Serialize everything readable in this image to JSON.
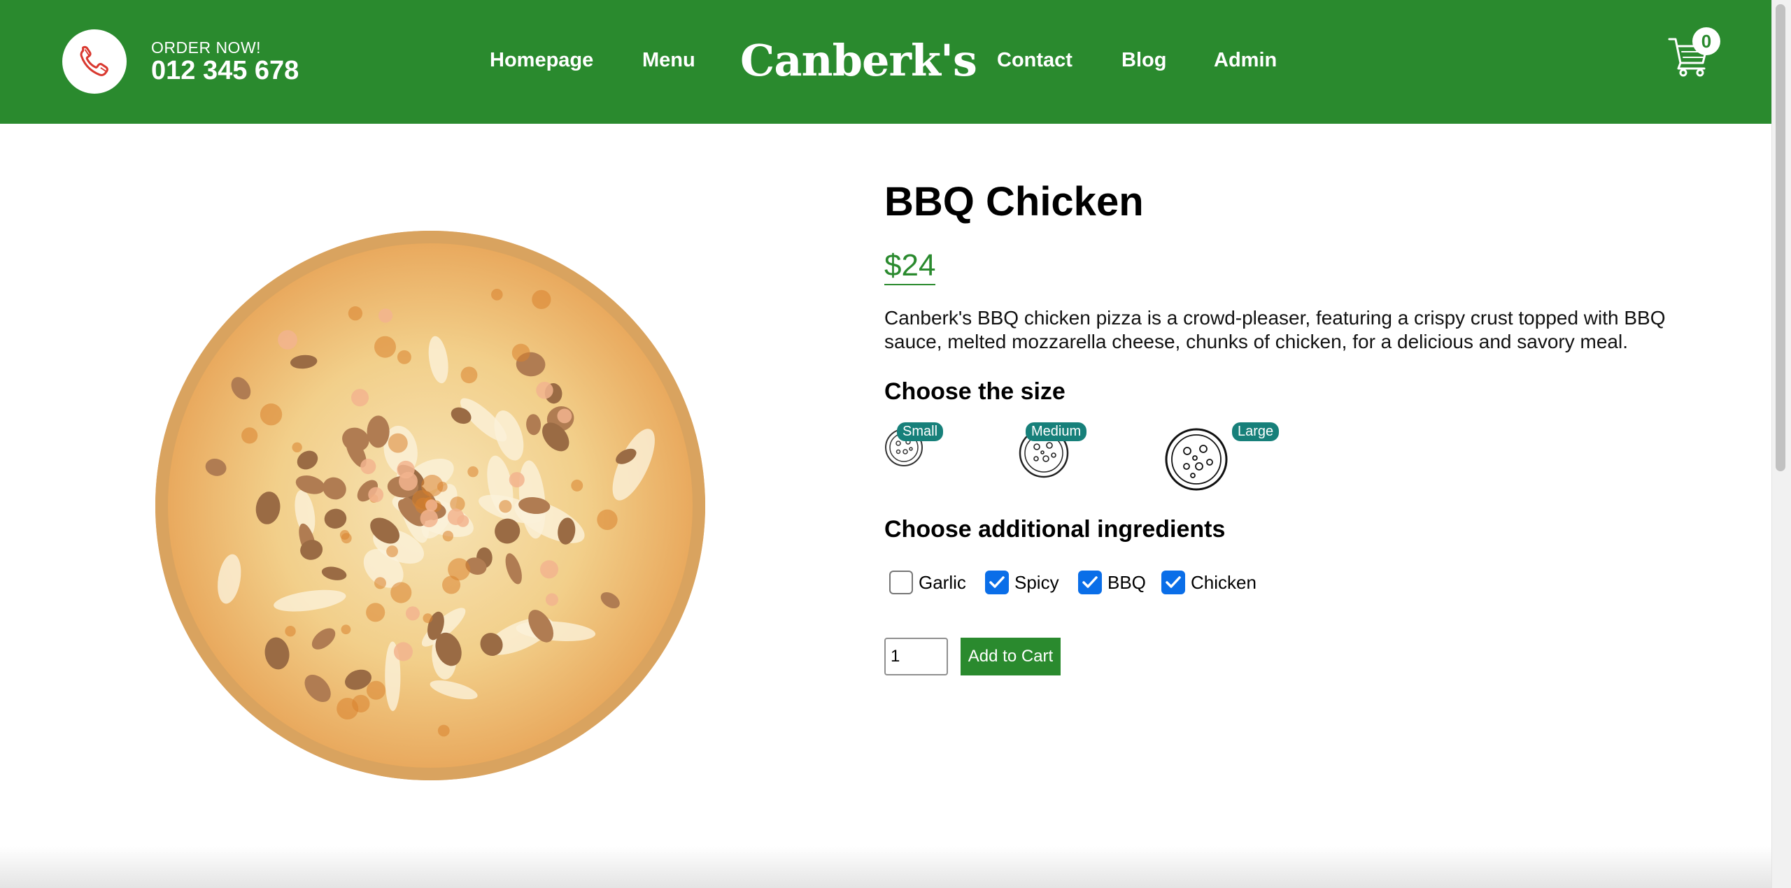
{
  "header": {
    "order_label": "ORDER NOW!",
    "phone_number": "012 345 678",
    "logo": "Canberk's",
    "nav_left": [
      "Homepage",
      "Menu"
    ],
    "nav_right": [
      "Contact",
      "Blog",
      "Admin"
    ],
    "cart_count": "0",
    "brand_color": "#2a8a2e"
  },
  "product": {
    "name": "BBQ Chicken",
    "price": "$24",
    "description": "Canberk's BBQ chicken pizza is a crowd-pleaser, featuring a crispy crust topped with BBQ sauce, melted mozzarella cheese, chunks of chicken, for a delicious and savory meal.",
    "size_heading": "Choose the size",
    "sizes": [
      "Small",
      "Medium",
      "Large"
    ],
    "ingredients_heading": "Choose additional ingredients",
    "ingredients": [
      {
        "label": "Garlic",
        "checked": false
      },
      {
        "label": "Spicy",
        "checked": true
      },
      {
        "label": "BBQ",
        "checked": true
      },
      {
        "label": "Chicken",
        "checked": true
      }
    ],
    "quantity": "1",
    "add_to_cart_label": "Add to Cart"
  },
  "icons": {
    "phone": "phone-icon",
    "cart": "cart-icon",
    "pizza_size": "pizza-icon"
  }
}
